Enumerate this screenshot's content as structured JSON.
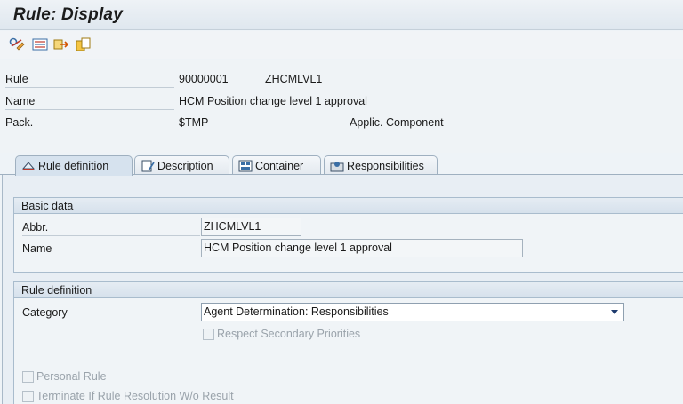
{
  "window": {
    "title": "Rule: Display"
  },
  "toolbar": {
    "icons": [
      "toggle-edit-icon",
      "definition-icon",
      "exit-icon",
      "copy-icon"
    ]
  },
  "header": {
    "rule_label": "Rule",
    "rule_number": "90000001",
    "rule_abbr": "ZHCMLVL1",
    "name_label": "Name",
    "name_value": "HCM Position change level 1 approval",
    "package_label": "Pack.",
    "package_value": "$TMP",
    "applic_label": "Applic. Component"
  },
  "tabs": [
    {
      "label": "Rule definition",
      "active": true
    },
    {
      "label": "Description",
      "active": false
    },
    {
      "label": "Container",
      "active": false
    },
    {
      "label": "Responsibilities",
      "active": false
    }
  ],
  "basic_data": {
    "heading": "Basic data",
    "abbr_label": "Abbr.",
    "abbr_value": "ZHCMLVL1",
    "name_label": "Name",
    "name_value": "HCM Position change level 1 approval"
  },
  "rule_definition": {
    "heading": "Rule definition",
    "category_label": "Category",
    "category_value": "Agent Determination: Responsibilities",
    "respect_secondary_label": "Respect Secondary Priorities",
    "personal_rule_label": "Personal Rule",
    "terminate_label": "Terminate If Rule Resolution W/o Result"
  }
}
